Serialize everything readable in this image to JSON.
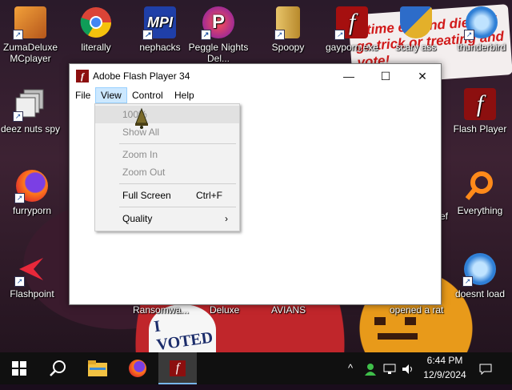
{
  "desktop": {
    "promo_text": "s time eat and die and go trick or treating and vote!",
    "voted_text": "I VOTED",
    "icons": [
      {
        "label": "ZumaDeluxe MCplayer",
        "icon": "zuma-icon"
      },
      {
        "label": "literally",
        "icon": "chrome-icon"
      },
      {
        "label": "nephacks",
        "icon": "mpi-icon"
      },
      {
        "label": "Peggle Nights Del...",
        "icon": "peggle-icon"
      },
      {
        "label": "Spoopy",
        "icon": "folder-zip-icon"
      },
      {
        "label": "gayporn.exe",
        "icon": "flash-icon"
      },
      {
        "label": "scary ass",
        "icon": "shield-icon"
      },
      {
        "label": "thunderbird",
        "icon": "thunderbird-icon"
      },
      {
        "label": "deez nuts spy",
        "icon": "stacked-pages-icon"
      },
      {
        "label": "Flash Player",
        "icon": "flash-icon"
      },
      {
        "label": "furryporn",
        "icon": "firefox-icon"
      },
      {
        "label": "Everything",
        "icon": "search-ring-icon"
      },
      {
        "label": "Flashpoint",
        "icon": "flashpoint-icon"
      },
      {
        "label": "doesnt load",
        "icon": "thunderbird-icon"
      }
    ],
    "partial_labels": {
      "ransomware": "Ransomwa...",
      "deluxe": "Deluxe",
      "avians": "AVIANS",
      "opened": "opened a rat",
      "ef": "ef"
    }
  },
  "window": {
    "title": "Adobe Flash Player 34",
    "minimize_symbol": "—",
    "maximize_symbol": "☐",
    "close_symbol": "✕",
    "menus": [
      "File",
      "View",
      "Control",
      "Help"
    ],
    "active_menu": "View"
  },
  "view_menu": {
    "items": [
      {
        "label": "100%",
        "shortcut": "",
        "disabled": true,
        "highlighted": true
      },
      {
        "label": "Show All",
        "shortcut": "",
        "disabled": true
      },
      {
        "label": "Zoom In",
        "shortcut": "",
        "disabled": true
      },
      {
        "label": "Zoom Out",
        "shortcut": "",
        "disabled": true
      },
      {
        "label": "Full Screen",
        "shortcut": "Ctrl+F",
        "disabled": false
      },
      {
        "label": "Quality",
        "shortcut": "",
        "disabled": false,
        "submenu_symbol": "›"
      }
    ]
  },
  "taskbar": {
    "start_icon": "windows-logo-icon",
    "search_icon": "search-icon",
    "apps": [
      "file-explorer-icon",
      "firefox-icon",
      "flash-icon"
    ],
    "tray_chevron": "^",
    "time": "6:44 PM",
    "date": "12/9/2024",
    "colors": {
      "accent": "#77b6ea",
      "background": "#101010"
    }
  }
}
